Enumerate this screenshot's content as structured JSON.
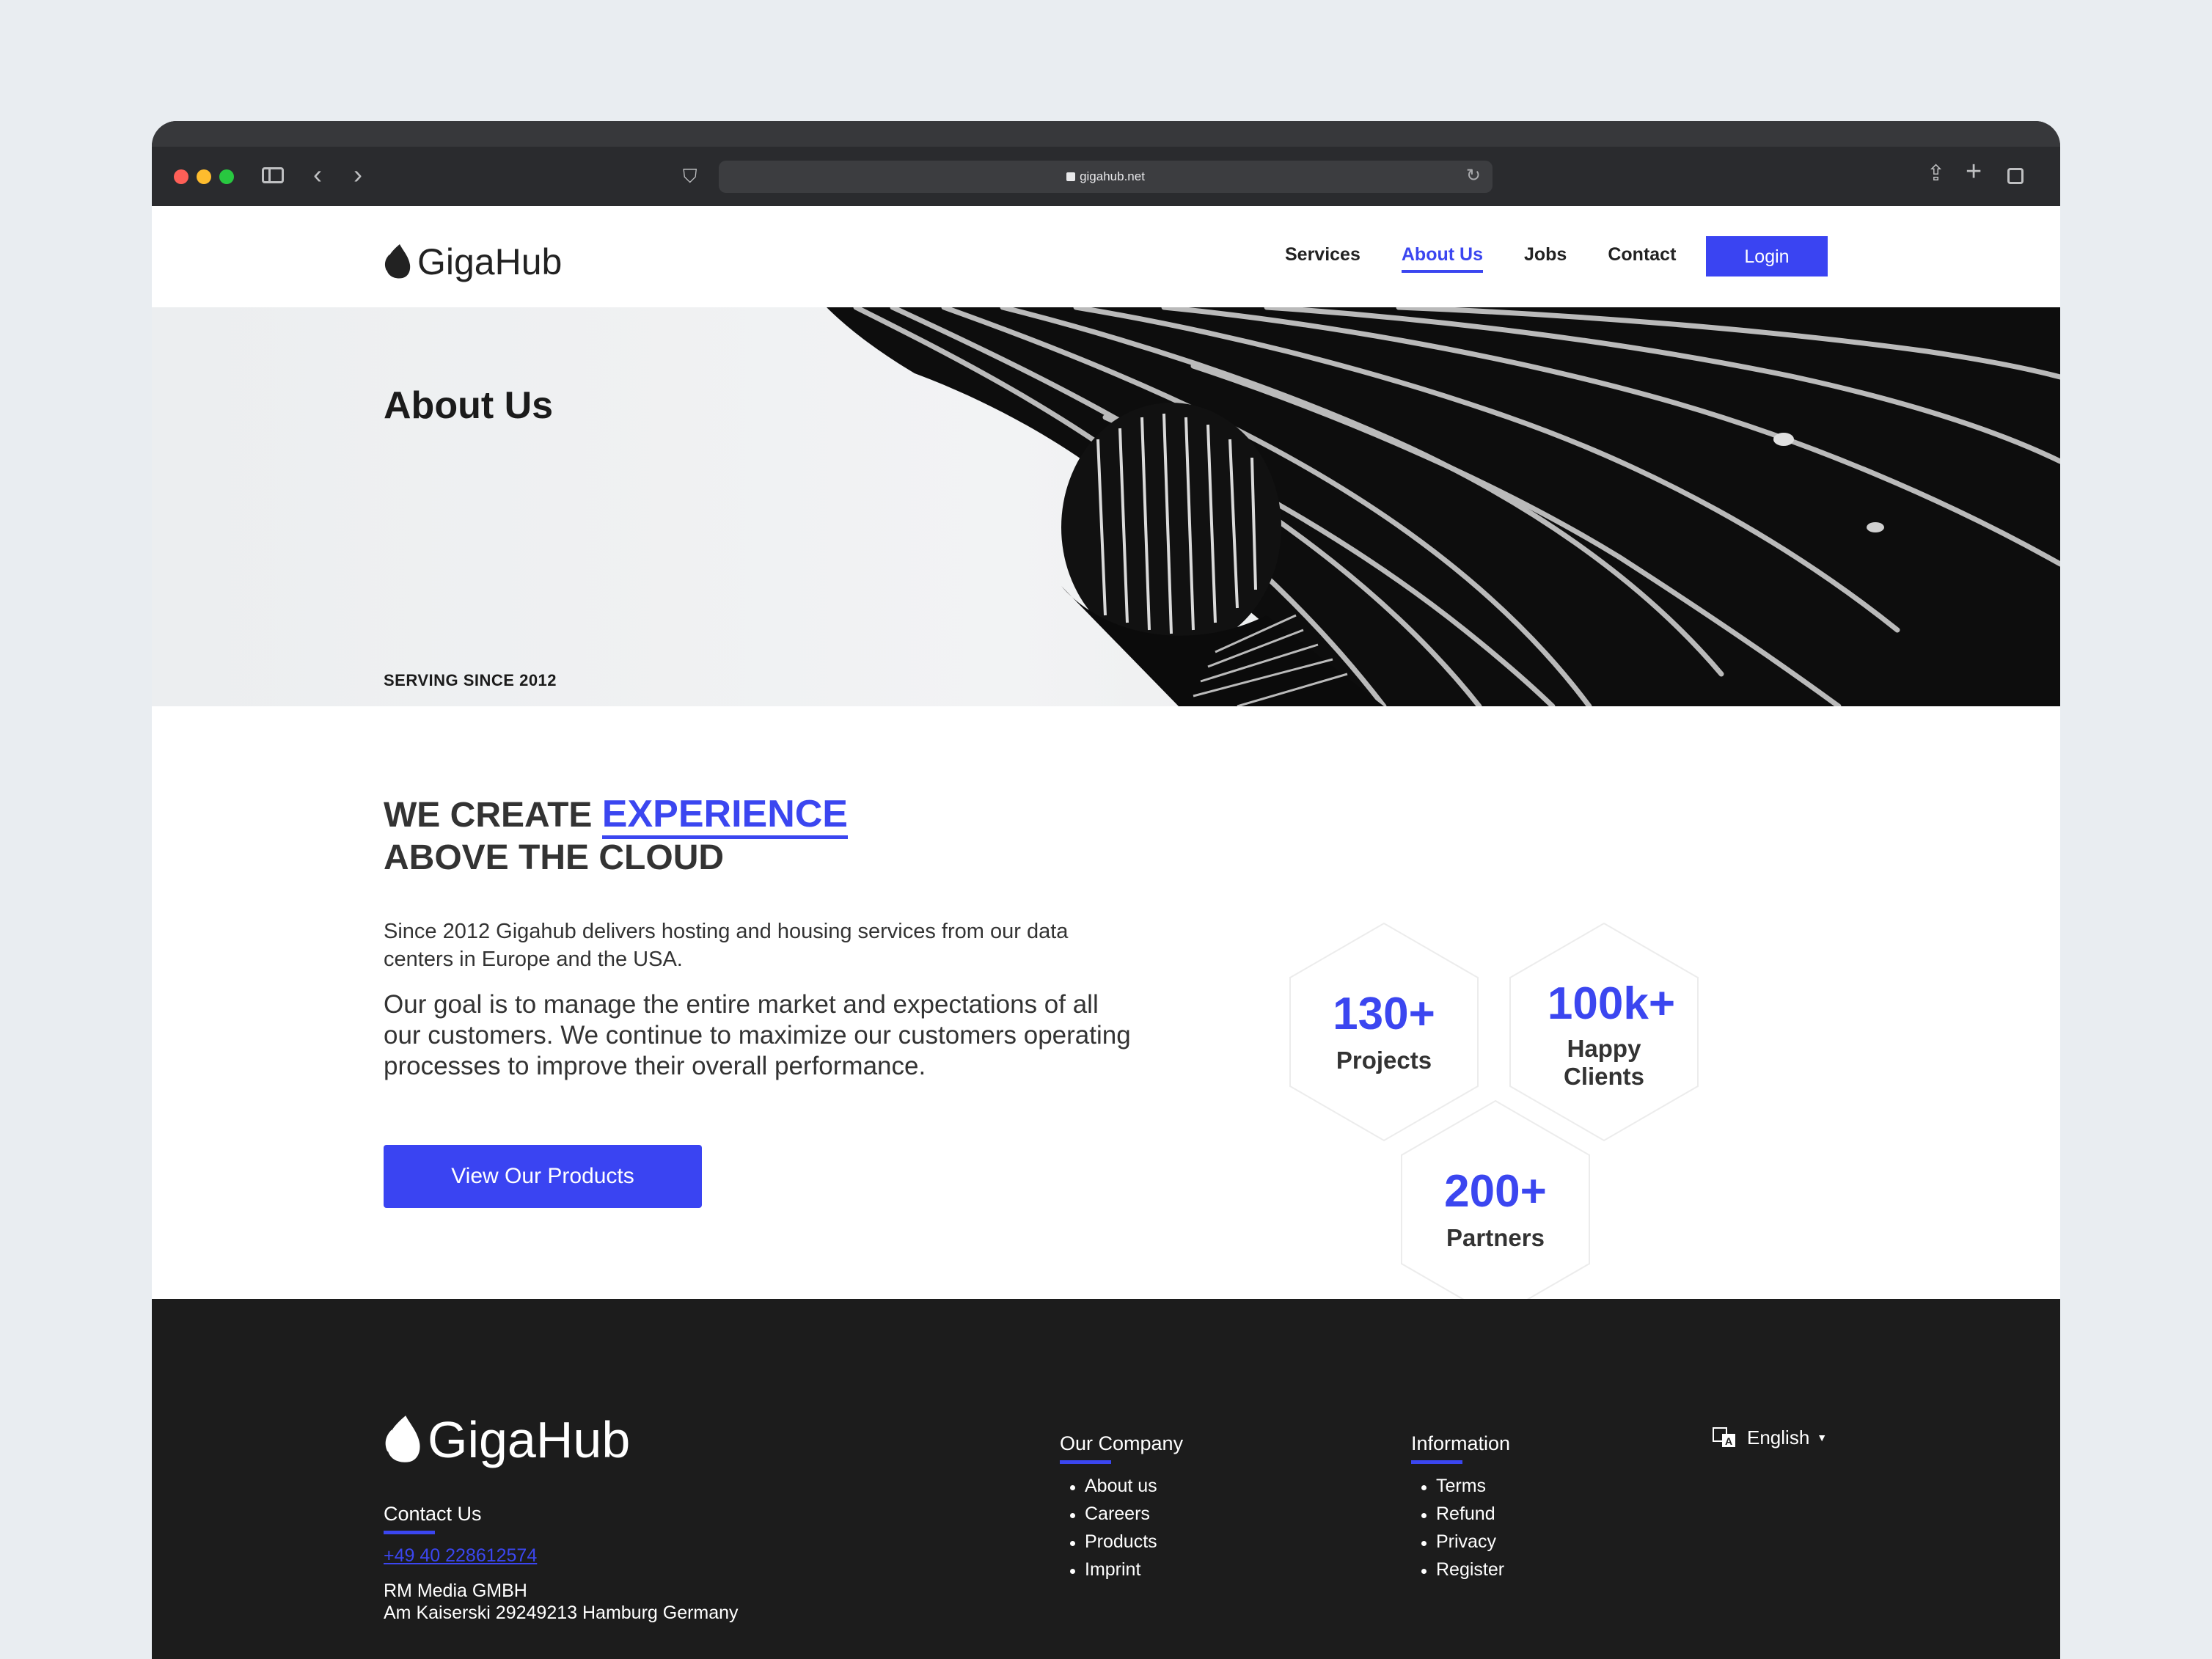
{
  "browser": {
    "url": "gigahub.net"
  },
  "header": {
    "logo_text": "GigaHub",
    "nav": [
      {
        "label": "Services"
      },
      {
        "label": "About Us"
      },
      {
        "label": "Jobs"
      },
      {
        "label": "Contact"
      }
    ],
    "login_label": "Login"
  },
  "hero": {
    "title": "About Us",
    "tagline": "SERVING SINCE 2012"
  },
  "main": {
    "headline_prefix": "WE CREATE",
    "headline_accent": "EXPERIENCE",
    "headline_line2": "ABOVE THE CLOUD",
    "paragraph1": "Since 2012 Gigahub delivers hosting and housing services from our data centers in Europe and the USA.",
    "paragraph2": "Our goal is to manage the entire market and expectations of all our customers. We continue to maximize our customers operating processes to improve their overall performance.",
    "cta_label": "View Our Products",
    "stats": [
      {
        "value": "130+",
        "label": "Projects"
      },
      {
        "value": "100k+",
        "label_line1": "Happy",
        "label_line2": "Clients"
      },
      {
        "value": "200+",
        "label": "Partners"
      }
    ]
  },
  "footer": {
    "logo_text": "GigaHub",
    "contact_heading": "Contact Us",
    "phone": "+49 40 228612574",
    "company": "RM Media GMBH",
    "address": "Am Kaiserski 29249213 Hamburg Germany",
    "our_company_heading": "Our Company",
    "our_company_links": [
      "About us",
      "Careers",
      "Products",
      "Imprint"
    ],
    "information_heading": "Information",
    "information_links": [
      "Terms",
      "Refund",
      "Privacy",
      "Register"
    ],
    "language": "English"
  },
  "colors": {
    "accent": "#3b46f0",
    "footer_bg": "#1c1c1c",
    "page_bg": "#e9edf1"
  }
}
